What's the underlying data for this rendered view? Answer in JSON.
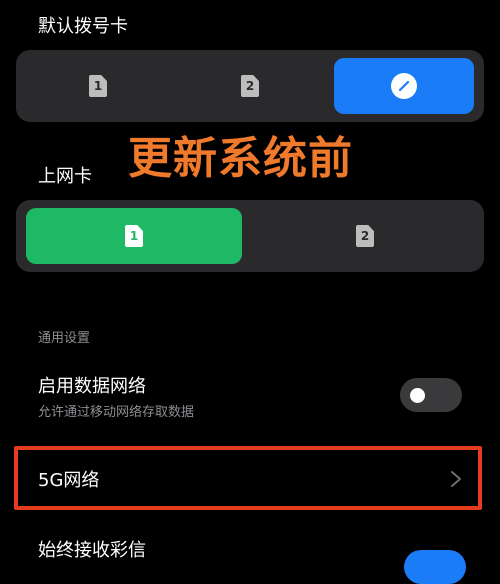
{
  "default_dial_card": {
    "title": "默认拨号卡",
    "options": [
      "1",
      "2",
      "auto"
    ],
    "selected": "auto"
  },
  "overlay_caption": "更新系统前",
  "data_card": {
    "title": "上网卡",
    "options": [
      "1",
      "2"
    ],
    "selected": "1"
  },
  "general_settings": {
    "header": "通用设置",
    "enable_data": {
      "title": "启用数据网络",
      "subtitle": "允许通过移动网络存取数据",
      "toggle_on": false
    },
    "five_g": {
      "title": "5G网络"
    },
    "always_receive_mms": {
      "title": "始终接收彩信"
    }
  },
  "colors": {
    "selected_blue": "#1a7cf7",
    "selected_green": "#1fb864",
    "highlight_red": "#e53c1e",
    "caption_orange": "#f07a2b"
  }
}
